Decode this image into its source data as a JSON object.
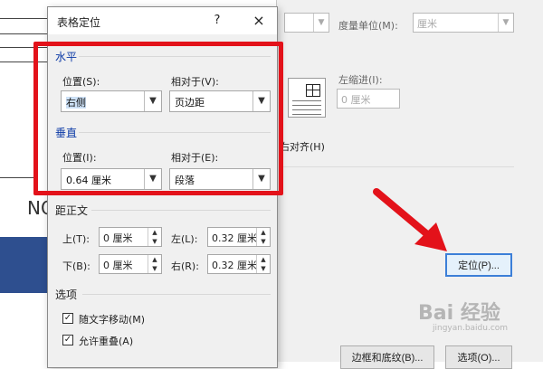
{
  "dialog": {
    "title": "表格定位",
    "help_icon": "?",
    "close_icon": "×",
    "horizontal": {
      "group_title": "水平",
      "position_label": "位置(S):",
      "position_value": "右侧",
      "relative_label": "相对于(V):",
      "relative_value": "页边距"
    },
    "vertical": {
      "group_title": "垂直",
      "position_label": "位置(I):",
      "position_value": "0.64 厘米",
      "relative_label": "相对于(E):",
      "relative_value": "段落"
    },
    "distance": {
      "group_title": "距正文",
      "top_label": "上(T):",
      "top_value": "0 厘米",
      "left_label": "左(L):",
      "left_value": "0.32 厘米",
      "bottom_label": "下(B):",
      "bottom_value": "0 厘米",
      "right_label": "右(R):",
      "right_value": "0.32 厘米"
    },
    "options": {
      "group_title": "选项",
      "move_with_text_label": "随文字移动(M)",
      "move_with_text_checked": true,
      "allow_overlap_label": "允许重叠(A)",
      "allow_overlap_checked": true
    }
  },
  "parent_dialog": {
    "unit_label": "度量单位(M):",
    "unit_value": "厘米",
    "indent_label": "左缩进(I):",
    "indent_value": "0 厘米",
    "align_right_label": "右对齐(H)",
    "position_button": "定位(P)...",
    "borders_button": "边框和底纹(B)...",
    "options_button": "选项(O)..."
  },
  "document": {
    "fragment_text": "NO"
  },
  "watermark": {
    "text": "Bai 经验",
    "sub": "jingyan.baidu.com"
  },
  "colors": {
    "annotation_red": "#e3121a",
    "group_title_blue": "#0c3aa6",
    "doc_blue": "#2e4f8f"
  }
}
